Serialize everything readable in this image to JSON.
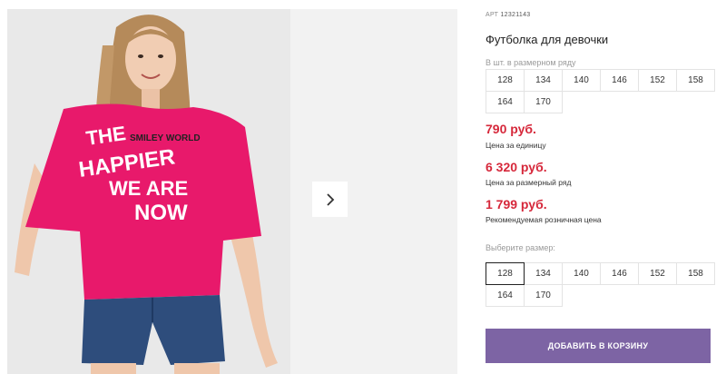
{
  "product": {
    "art_label": "АРТ",
    "art_number": "12321143",
    "title": "Футболка для девочки",
    "gallery": {
      "image_alt": "girl wearing pink t-shirt and denim shorts",
      "shirt_print_1": "THE",
      "shirt_print_2": "HAPPIER",
      "shirt_print_3": "SMILEY WORLD",
      "shirt_print_4": "WE ARE",
      "shirt_print_5": "NOW",
      "next_icon": "chevron-right-icon"
    }
  },
  "size_row": {
    "label": "В шт. в размерном ряду",
    "sizes": [
      "128",
      "134",
      "140",
      "146",
      "152",
      "158",
      "164",
      "170"
    ]
  },
  "prices": {
    "unit_price": "790 руб.",
    "unit_label": "Цена за единицу",
    "row_price": "6 320 руб.",
    "row_label": "Цена за размерный ряд",
    "retail_price": "1 799 руб.",
    "retail_label": "Рекомендуемая розничная цена"
  },
  "size_select": {
    "label": "Выберите размер:",
    "sizes": [
      "128",
      "134",
      "140",
      "146",
      "152",
      "158",
      "164",
      "170"
    ],
    "selected": "128"
  },
  "cart": {
    "button_label": "ДОБАВИТЬ В КОРЗИНУ"
  },
  "colors": {
    "price_red": "#d6283b",
    "button_purple": "#7d64a4",
    "shirt_pink": "#e8196b"
  }
}
